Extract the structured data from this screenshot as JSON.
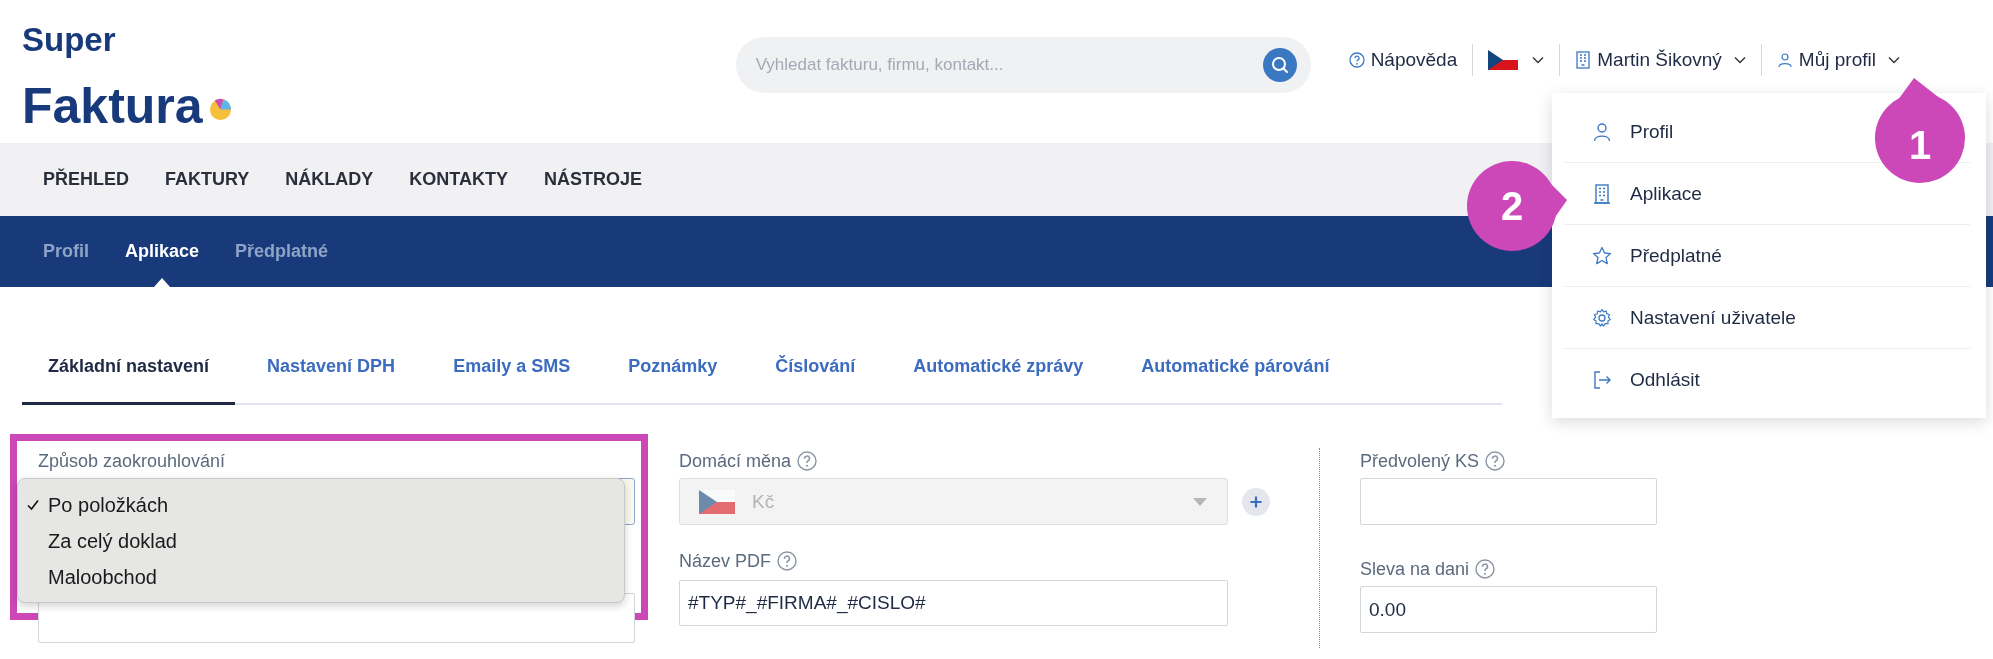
{
  "logo": {
    "line1": "Super",
    "line2": "Faktura"
  },
  "search": {
    "placeholder": "Vyhledat fakturu, firmu, kontakt..."
  },
  "header": {
    "help": "Nápověda",
    "company": "Martin Šikovný",
    "profile": {
      "label": "Můj profil",
      "expanded": true
    }
  },
  "profile_menu": [
    {
      "label": "Profil"
    },
    {
      "label": "Aplikace"
    },
    {
      "label": "Předplatné"
    },
    {
      "label": "Nastavení uživatele"
    },
    {
      "label": "Odhlásit"
    }
  ],
  "main_nav": [
    {
      "label": "PŘEHLED"
    },
    {
      "label": "FAKTURY"
    },
    {
      "label": "NÁKLADY"
    },
    {
      "label": "KONTAKTY"
    },
    {
      "label": "NÁSTROJE"
    }
  ],
  "sub_nav": [
    {
      "label": "Profil",
      "selected": false
    },
    {
      "label": "Aplikace",
      "selected": true
    },
    {
      "label": "Předplatné",
      "selected": false
    }
  ],
  "tabs": [
    {
      "label": "Základní nastavení",
      "selected": true
    },
    {
      "label": "Nastavení DPH",
      "selected": false
    },
    {
      "label": "Emaily a SMS",
      "selected": false
    },
    {
      "label": "Poznámky",
      "selected": false
    },
    {
      "label": "Číslování",
      "selected": false
    },
    {
      "label": "Automatické zprávy",
      "selected": false
    },
    {
      "label": "Automatické párování",
      "selected": false
    }
  ],
  "form": {
    "rounding": {
      "label": "Způsob zaokrouhlování",
      "options": [
        {
          "label": "Po položkách",
          "checked": true
        },
        {
          "label": "Za celý doklad",
          "checked": false
        },
        {
          "label": "Maloobchod",
          "checked": false
        }
      ]
    },
    "currency": {
      "label": "Domácí měna",
      "value": "Kč",
      "disabled": true
    },
    "pdf_name": {
      "label": "Název PDF",
      "value": "#TYP#_#FIRMA#_#CISLO#"
    },
    "default_ks": {
      "label": "Předvolený KS"
    },
    "tax_discount": {
      "label": "Sleva na dani",
      "value": "0.00"
    }
  },
  "callouts": [
    {
      "label": "1"
    },
    {
      "label": "2"
    }
  ]
}
